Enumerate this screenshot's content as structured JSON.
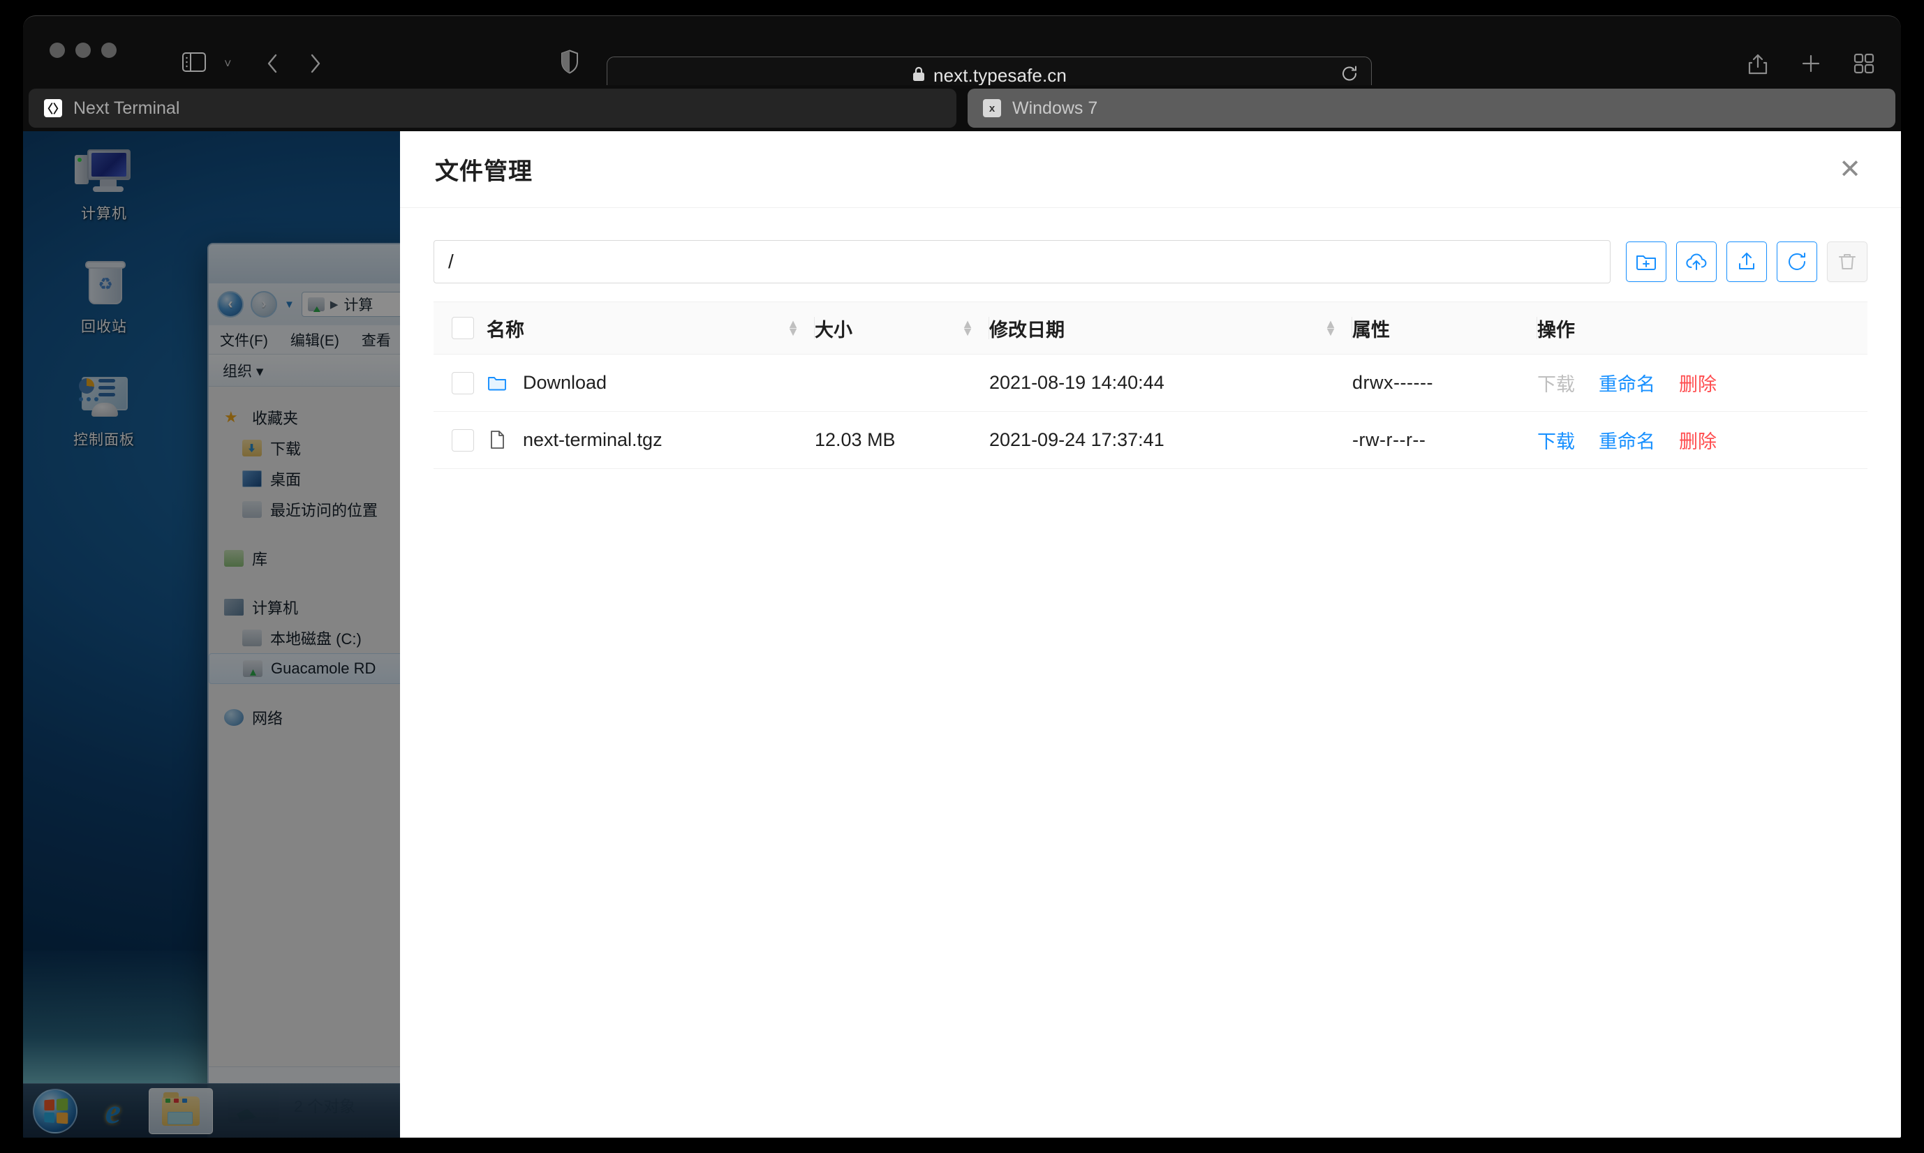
{
  "browser": {
    "window_controls": [
      "close",
      "minimize",
      "maximize"
    ],
    "url": "next.typesafe.cn",
    "lock_glyph": "🔒",
    "icons": {
      "sidebar": "sidebar-icon",
      "back": "back-arrow-icon",
      "forward": "forward-arrow-icon",
      "shield": "privacy-shield-icon",
      "reload": "reload-icon",
      "share": "share-icon",
      "new_tab": "plus-icon",
      "tab_overview": "tab-overview-icon"
    },
    "tabs": [
      {
        "title": "Next Terminal",
        "favicon": "〈〉",
        "active": false
      },
      {
        "title": "Windows 7",
        "favicon": "x",
        "active": true
      }
    ]
  },
  "desktop": {
    "icons": [
      {
        "label": "计算机",
        "icon": "computer-icon"
      },
      {
        "label": "回收站",
        "icon": "recycle-bin-icon"
      },
      {
        "label": "控制面板",
        "icon": "control-panel-icon"
      }
    ],
    "explorer": {
      "address": "计算",
      "menu": [
        "文件(F)",
        "编辑(E)",
        "查看"
      ],
      "organize": "组织 ▾",
      "tree": [
        {
          "label": "收藏夹",
          "icon": "favorites-star-icon",
          "indent": false,
          "selected": false,
          "gap": false
        },
        {
          "label": "下载",
          "icon": "downloads-icon",
          "indent": true,
          "selected": false,
          "gap": false
        },
        {
          "label": "桌面",
          "icon": "desktop-icon",
          "indent": true,
          "selected": false,
          "gap": false
        },
        {
          "label": "最近访问的位置",
          "icon": "recent-places-icon",
          "indent": true,
          "selected": false,
          "gap": false
        },
        {
          "label": "库",
          "icon": "library-icon",
          "indent": false,
          "selected": false,
          "gap": true
        },
        {
          "label": "计算机",
          "icon": "computer-small-icon",
          "indent": false,
          "selected": false,
          "gap": true
        },
        {
          "label": "本地磁盘 (C:)",
          "icon": "local-disk-icon",
          "indent": true,
          "selected": false,
          "gap": false
        },
        {
          "label": "Guacamole RD",
          "icon": "network-drive-icon",
          "indent": true,
          "selected": true,
          "gap": false
        },
        {
          "label": "网络",
          "icon": "network-icon",
          "indent": false,
          "selected": false,
          "gap": true
        }
      ],
      "status": "2 个对象"
    },
    "taskbar": {
      "start": "windows-start-orb",
      "items": [
        {
          "icon": "internet-explorer-icon",
          "pinned": true
        },
        {
          "icon": "windows-explorer-icon",
          "pinned": true
        }
      ]
    }
  },
  "modal": {
    "title": "文件管理",
    "close_label": "✕",
    "path": {
      "value": "/",
      "placeholder": "/"
    },
    "toolbar_buttons": [
      {
        "name": "new-folder-button",
        "icon": "folder-plus-icon",
        "disabled": false
      },
      {
        "name": "upload-cloud-button",
        "icon": "cloud-upload-icon",
        "disabled": false
      },
      {
        "name": "upload-file-button",
        "icon": "upload-icon",
        "disabled": false
      },
      {
        "name": "refresh-button",
        "icon": "refresh-icon",
        "disabled": false
      },
      {
        "name": "delete-button",
        "icon": "trash-icon",
        "disabled": true
      }
    ],
    "table": {
      "columns": [
        {
          "key": "name",
          "label": "名称",
          "sortable": true
        },
        {
          "key": "size",
          "label": "大小",
          "sortable": true
        },
        {
          "key": "modified",
          "label": "修改日期",
          "sortable": true
        },
        {
          "key": "attr",
          "label": "属性",
          "sortable": false
        },
        {
          "key": "actions",
          "label": "操作",
          "sortable": false
        }
      ],
      "rows": [
        {
          "name": "Download",
          "icon": "folder-icon",
          "size": "",
          "modified": "2021-08-19 14:40:44",
          "attr": "drwx------",
          "actions": [
            {
              "label": "下载",
              "style": "muted"
            },
            {
              "label": "重命名",
              "style": "link"
            },
            {
              "label": "删除",
              "style": "danger"
            }
          ]
        },
        {
          "name": "next-terminal.tgz",
          "icon": "file-icon",
          "size": "12.03 MB",
          "modified": "2021-09-24 17:37:41",
          "attr": "-rw-r--r--",
          "actions": [
            {
              "label": "下载",
              "style": "link"
            },
            {
              "label": "重命名",
              "style": "link"
            },
            {
              "label": "删除",
              "style": "danger"
            }
          ]
        }
      ]
    }
  },
  "colors": {
    "primary": "#1890ff",
    "danger": "#ff4d4f",
    "muted": "#bfbfbf",
    "border": "#f0f0f0",
    "header_bg": "#fafafa"
  }
}
